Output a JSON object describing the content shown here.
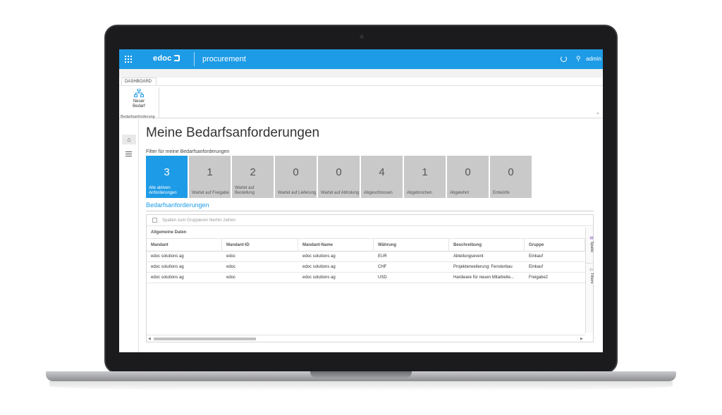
{
  "topbar": {
    "brand": "edoc",
    "app_name": "procurement",
    "user": "admin"
  },
  "ribbon": {
    "tab": "DASHBOARD",
    "button_label_1": "Neuer",
    "button_label_2": "Bedarf",
    "group_label": "Bedarfsanforderung"
  },
  "main": {
    "title": "Meine Bedarfsanforderungen",
    "filter_label": "Filter für meine Bedarfsanforderungen",
    "tiles": [
      {
        "count": "3",
        "label": "Alle aktiven Anforderungen"
      },
      {
        "count": "1",
        "label": "Wartet auf Freigabe"
      },
      {
        "count": "2",
        "label": "Wartet auf Bestellung"
      },
      {
        "count": "0",
        "label": "Wartet auf Lieferung"
      },
      {
        "count": "0",
        "label": "Wartet auf Abholung"
      },
      {
        "count": "4",
        "label": "Abgeschlossen"
      },
      {
        "count": "1",
        "label": "Abgebrochen"
      },
      {
        "count": "0",
        "label": "Abgelehnt"
      },
      {
        "count": "0",
        "label": "Entwürfe"
      }
    ],
    "section_title": "Bedarfsanforderungen"
  },
  "grid": {
    "group_hint": "Spalten zum Gruppieren hierhin ziehen",
    "band": "Allgemeine Daten",
    "columns": [
      "Mandant",
      "Mandant-ID",
      "Mandant-Name",
      "Währung",
      "Beschreibung",
      "Gruppe"
    ],
    "rows": [
      [
        "edoc solutions ag",
        "edoc",
        "edoc solutions ag",
        "EUR",
        "Abteilungsevent",
        "Einkauf"
      ],
      [
        "edoc solutions ag",
        "edoc",
        "edoc solutions ag",
        "CHF",
        "Projekterweiterung: Fensterbau",
        "Einkauf"
      ],
      [
        "edoc solutions ag",
        "edoc",
        "edoc solutions ag",
        "USD",
        "Hardware für neuen Mitarbeite...",
        "Freigabe2"
      ]
    ],
    "side_tabs": [
      "Spalte",
      "Filters"
    ]
  },
  "colors": {
    "accent": "#1e9be6",
    "tile_inactive": "#c9c9c9"
  }
}
